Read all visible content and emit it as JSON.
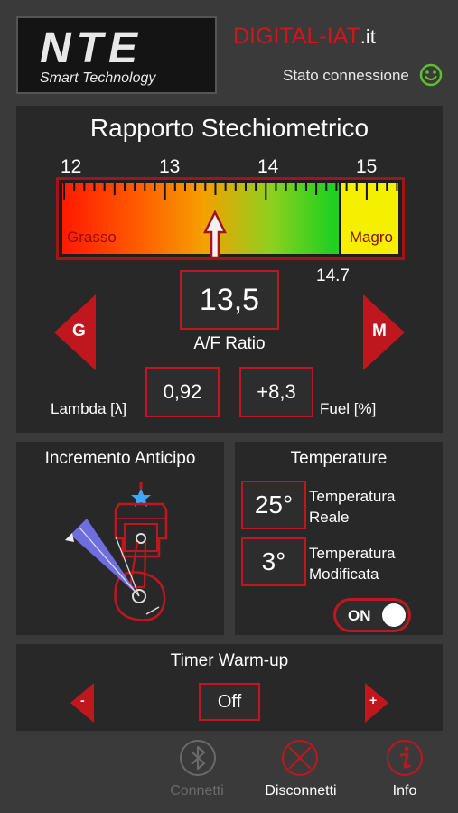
{
  "header": {
    "logo_text": "NTE",
    "logo_sub": "Smart Technology",
    "brand_main": "DIGITAL-IAT",
    "brand_suffix": ".it",
    "connection_label": "Stato connessione",
    "connection_icon": "smiley-connected-icon",
    "connection_color": "#5cc12a"
  },
  "ratio_panel": {
    "title": "Rapporto Stechiometrico",
    "scale_labels": [
      "12",
      "13",
      "14",
      "15"
    ],
    "rich_label": "Grasso",
    "lean_label": "Magro",
    "lean_threshold": "14.7",
    "pointer_value": 13.5,
    "afr_value": "13,5",
    "afr_label": "A/F Ratio",
    "rich_button": "G",
    "lean_button": "M",
    "lambda_label": "Lambda [λ]",
    "lambda_value": "0,92",
    "fuel_value": "+8,3",
    "fuel_label": "Fuel [%]"
  },
  "advance_panel": {
    "title": "Incremento Anticipo"
  },
  "temperature_panel": {
    "title": "Temperature",
    "real_value": "25°",
    "real_label_1": "Temperatura",
    "real_label_2": "Reale",
    "mod_value": "3°",
    "mod_label_1": "Temperatura",
    "mod_label_2": "Modificata",
    "toggle_label": "ON",
    "toggle_on": true
  },
  "timer_panel": {
    "title": "Timer Warm-up",
    "minus_label": "-",
    "plus_label": "+",
    "value": "Off"
  },
  "bottom_nav": {
    "connect_label": "Connetti",
    "disconnect_label": "Disconnetti",
    "info_label": "Info",
    "connect_icon": "bluetooth-icon",
    "disconnect_icon": "disconnect-icon",
    "info_icon": "info-icon"
  },
  "colors": {
    "accent": "#c0171f",
    "panel": "#282828",
    "background": "#3a3a3a"
  }
}
